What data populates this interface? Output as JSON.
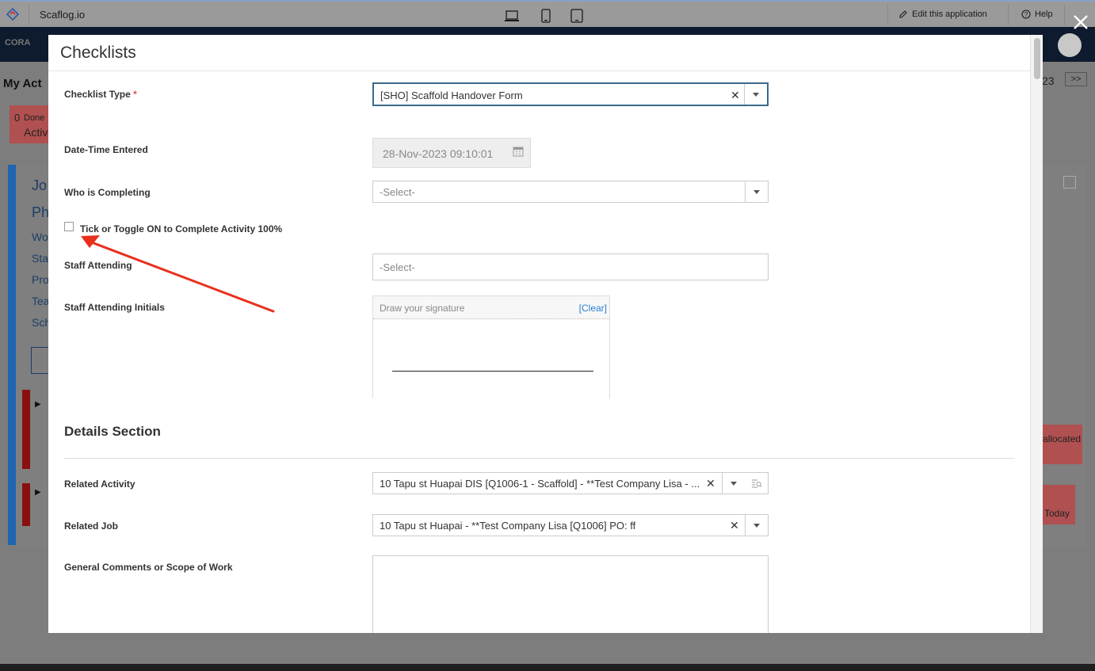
{
  "app": {
    "name": "Scaflog.io",
    "edit_label": "Edit this application",
    "help_label": "Help",
    "brand_fragment": "CORA"
  },
  "background": {
    "heading": "My Act",
    "done_count": "0",
    "done_label": "Done",
    "activ_label": "Activ",
    "frag_jo": "Jo",
    "frag_ph": "Ph",
    "frag_wo": "Wo",
    "frag_sta": "Sta",
    "frag_pro": "Pro",
    "frag_tea": "Tea",
    "frag_sch": "Sch",
    "frag_year": "23",
    "next_label": ">>",
    "allocated_label": "allocated",
    "today_label": "Today"
  },
  "modal": {
    "title": "Checklists",
    "checklist_type": {
      "label": "Checklist Type",
      "required_mark": "*",
      "value": "[SHO] Scaffold Handover Form"
    },
    "date_time": {
      "label": "Date-Time Entered",
      "value": "28-Nov-2023 09:10:01"
    },
    "who_completing": {
      "label": "Who is Completing",
      "placeholder": "-Select-"
    },
    "complete_toggle": {
      "label": "Tick or Toggle ON to Complete Activity 100%",
      "checked": false
    },
    "staff_attending": {
      "label": "Staff Attending",
      "placeholder": "-Select-"
    },
    "staff_initials": {
      "label": "Staff Attending Initials",
      "placeholder": "Draw your signature",
      "clear_label": "[Clear]"
    },
    "details_section": {
      "title": "Details Section",
      "related_activity": {
        "label": "Related Activity",
        "value": "10 Tapu st Huapai DIS [Q1006-1 - Scaffold] - **Test Company Lisa - ..."
      },
      "related_job": {
        "label": "Related Job",
        "value": "10 Tapu st Huapai - **Test Company Lisa [Q1006] PO: ff"
      },
      "general_comments": {
        "label": "General Comments or Scope of Work",
        "value": ""
      }
    }
  },
  "icons": {
    "clear": "close-icon",
    "dropdown": "chevron-down-icon",
    "calendar": "calendar-icon",
    "lookup": "search-list-icon"
  },
  "colors": {
    "annotation_arrow": "#e8301c",
    "required": "#d9534f",
    "link": "#2a7fd0",
    "focus_border": "#3c6a8a"
  }
}
